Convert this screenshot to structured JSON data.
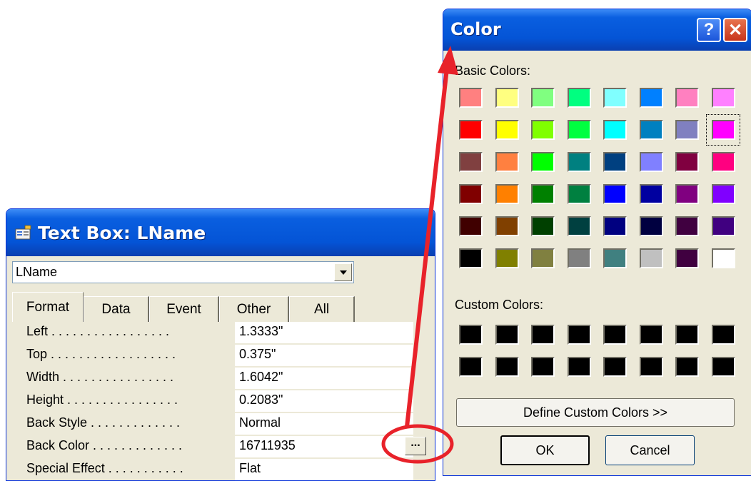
{
  "props_window": {
    "title": "Text Box: LName",
    "icon": "properties-icon",
    "object_selector": {
      "value": "LName"
    },
    "tabs": [
      {
        "label": "Format",
        "active": true
      },
      {
        "label": "Data",
        "active": false
      },
      {
        "label": "Event",
        "active": false
      },
      {
        "label": "Other",
        "active": false
      },
      {
        "label": "All",
        "active": false
      }
    ],
    "properties": [
      {
        "label": "Left . . . . . . . . . . . . . . . . .",
        "value": "1.3333\""
      },
      {
        "label": "Top . . . . . . . . . . . . . . . . . .",
        "value": "0.375\""
      },
      {
        "label": "Width . . . . . . . . . . . . . . . .",
        "value": "1.6042\""
      },
      {
        "label": "Height . . . . . . . . . . . . . . . .",
        "value": "0.2083\""
      },
      {
        "label": "Back Style . . . . . . . . . . . . .",
        "value": "Normal"
      },
      {
        "label": "Back Color . . . . . . . . . . . . .",
        "value": "16711935"
      },
      {
        "label": "Special Effect . . . . . . . . . . .",
        "value": "Flat"
      }
    ],
    "builder_button": {
      "label": "..."
    }
  },
  "color_dialog": {
    "title": "Color",
    "help_glyph": "?",
    "close_glyph": "✕",
    "basic_label": "Basic Colors:",
    "basic_colors": [
      [
        "#ff8080",
        "#ffff80",
        "#80ff80",
        "#00ff80",
        "#80ffff",
        "#0080ff",
        "#ff80c0",
        "#ff80ff"
      ],
      [
        "#ff0000",
        "#ffff00",
        "#80ff00",
        "#00ff40",
        "#00ffff",
        "#0080c0",
        "#8080c0",
        "#ff00ff"
      ],
      [
        "#804040",
        "#ff8040",
        "#00ff00",
        "#008080",
        "#004080",
        "#8080ff",
        "#800040",
        "#ff0080"
      ],
      [
        "#800000",
        "#ff8000",
        "#008000",
        "#008040",
        "#0000ff",
        "#0000a0",
        "#800080",
        "#8000ff"
      ],
      [
        "#400000",
        "#804000",
        "#004000",
        "#004040",
        "#000080",
        "#000040",
        "#400040",
        "#400080"
      ],
      [
        "#000000",
        "#808000",
        "#808040",
        "#808080",
        "#408080",
        "#c0c0c0",
        "#400040",
        "#ffffff"
      ]
    ],
    "selected_basic": {
      "row": 1,
      "col": 7
    },
    "custom_label": "Custom Colors:",
    "custom_colors": [
      [
        "#000000",
        "#000000",
        "#000000",
        "#000000",
        "#000000",
        "#000000",
        "#000000",
        "#000000"
      ],
      [
        "#000000",
        "#000000",
        "#000000",
        "#000000",
        "#000000",
        "#000000",
        "#000000",
        "#000000"
      ]
    ],
    "define_button": "Define Custom Colors >>",
    "ok_button": "OK",
    "cancel_button": "Cancel"
  },
  "annotation_color": "#e8222a"
}
